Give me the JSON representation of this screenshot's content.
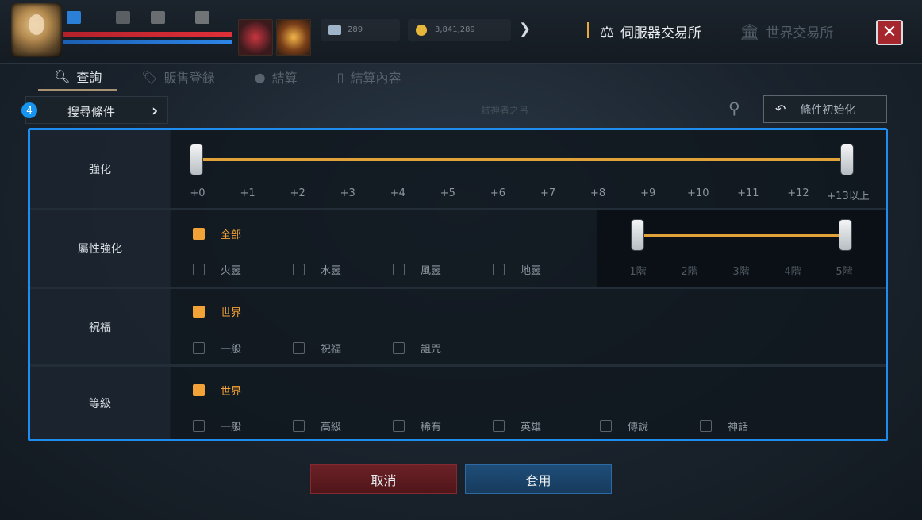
{
  "window": {
    "server_market_label": "伺服器交易所",
    "world_market_label": "世界交易所",
    "close_label": "✕"
  },
  "currency": {
    "diamond_amount": "289",
    "gold_amount": "3,841,289"
  },
  "tabs": [
    {
      "label": "查詢",
      "icon": "search-icon",
      "active": true
    },
    {
      "label": "販售登錄",
      "icon": "tag-icon",
      "active": false
    },
    {
      "label": "結算",
      "icon": "coins-icon",
      "active": false
    },
    {
      "label": "結算內容",
      "icon": "receipt-icon",
      "active": false
    }
  ],
  "filter": {
    "condition_label": "搜尋條件",
    "condition_count": "4",
    "search_placeholder": "弒神者之弓",
    "reset_label": "條件初始化"
  },
  "enhance": {
    "label": "強化",
    "ticks": [
      "+0",
      "+1",
      "+2",
      "+3",
      "+4",
      "+5",
      "+6",
      "+7",
      "+8",
      "+9",
      "+10",
      "+11",
      "+12",
      "+13以上"
    ],
    "range": [
      "+0",
      "+13以上"
    ]
  },
  "attribute": {
    "label": "屬性強化",
    "all_label": "全部",
    "all_checked": true,
    "options": [
      {
        "label": "火靈",
        "checked": false
      },
      {
        "label": "水靈",
        "checked": false
      },
      {
        "label": "風靈",
        "checked": false
      },
      {
        "label": "地靈",
        "checked": false
      }
    ],
    "ticks": [
      "1階",
      "2階",
      "3階",
      "4階",
      "5階"
    ],
    "range": [
      "1階",
      "5階"
    ]
  },
  "blessing": {
    "label": "祝福",
    "all_label": "世界",
    "all_checked": true,
    "options": [
      {
        "label": "一般",
        "checked": false
      },
      {
        "label": "祝福",
        "checked": false
      },
      {
        "label": "詛咒",
        "checked": false
      }
    ]
  },
  "grade": {
    "label": "等級",
    "all_label": "世界",
    "all_checked": true,
    "options": [
      {
        "label": "一般",
        "checked": false
      },
      {
        "label": "高級",
        "checked": false
      },
      {
        "label": "稀有",
        "checked": false
      },
      {
        "label": "英雄",
        "checked": false
      },
      {
        "label": "傳說",
        "checked": false
      },
      {
        "label": "神話",
        "checked": false
      }
    ]
  },
  "buttons": {
    "cancel_label": "取消",
    "apply_label": "套用"
  },
  "colors": {
    "accent_orange": "#f3a237",
    "highlight_blue": "#1f8df0",
    "close_red": "#a6262d"
  }
}
